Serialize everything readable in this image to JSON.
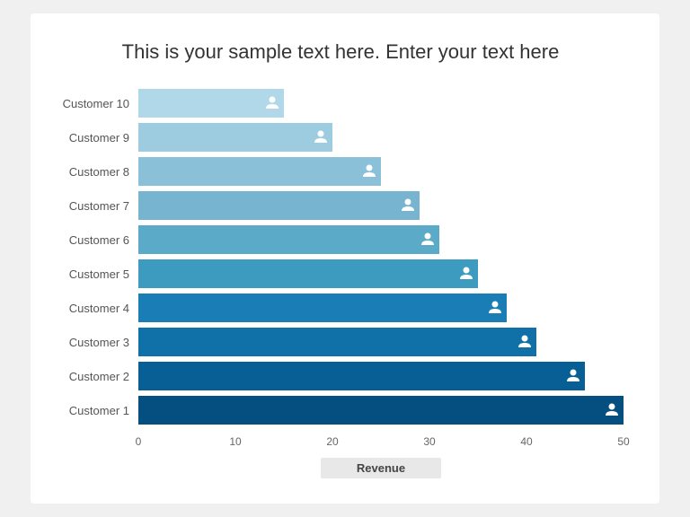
{
  "title": "This is your sample text here. Enter your text here",
  "chart": {
    "x_axis_label": "Revenue",
    "x_ticks": [
      0,
      10,
      20,
      30,
      40,
      50
    ],
    "max_value": 50,
    "bars": [
      {
        "label": "Customer 10",
        "value": 15,
        "color": "#b0d8e8"
      },
      {
        "label": "Customer 9",
        "value": 20,
        "color": "#9dcce0"
      },
      {
        "label": "Customer 8",
        "value": 25,
        "color": "#8ac0d8"
      },
      {
        "label": "Customer 7",
        "value": 29,
        "color": "#76b4d0"
      },
      {
        "label": "Customer 6",
        "value": 31,
        "color": "#5aaac8"
      },
      {
        "label": "Customer 5",
        "value": 35,
        "color": "#3d9bbf"
      },
      {
        "label": "Customer 4",
        "value": 38,
        "color": "#1a7db5"
      },
      {
        "label": "Customer 3",
        "value": 41,
        "color": "#1070a8"
      },
      {
        "label": "Customer 2",
        "value": 46,
        "color": "#085f96"
      },
      {
        "label": "Customer 1",
        "value": 50,
        "color": "#054e80"
      }
    ]
  }
}
